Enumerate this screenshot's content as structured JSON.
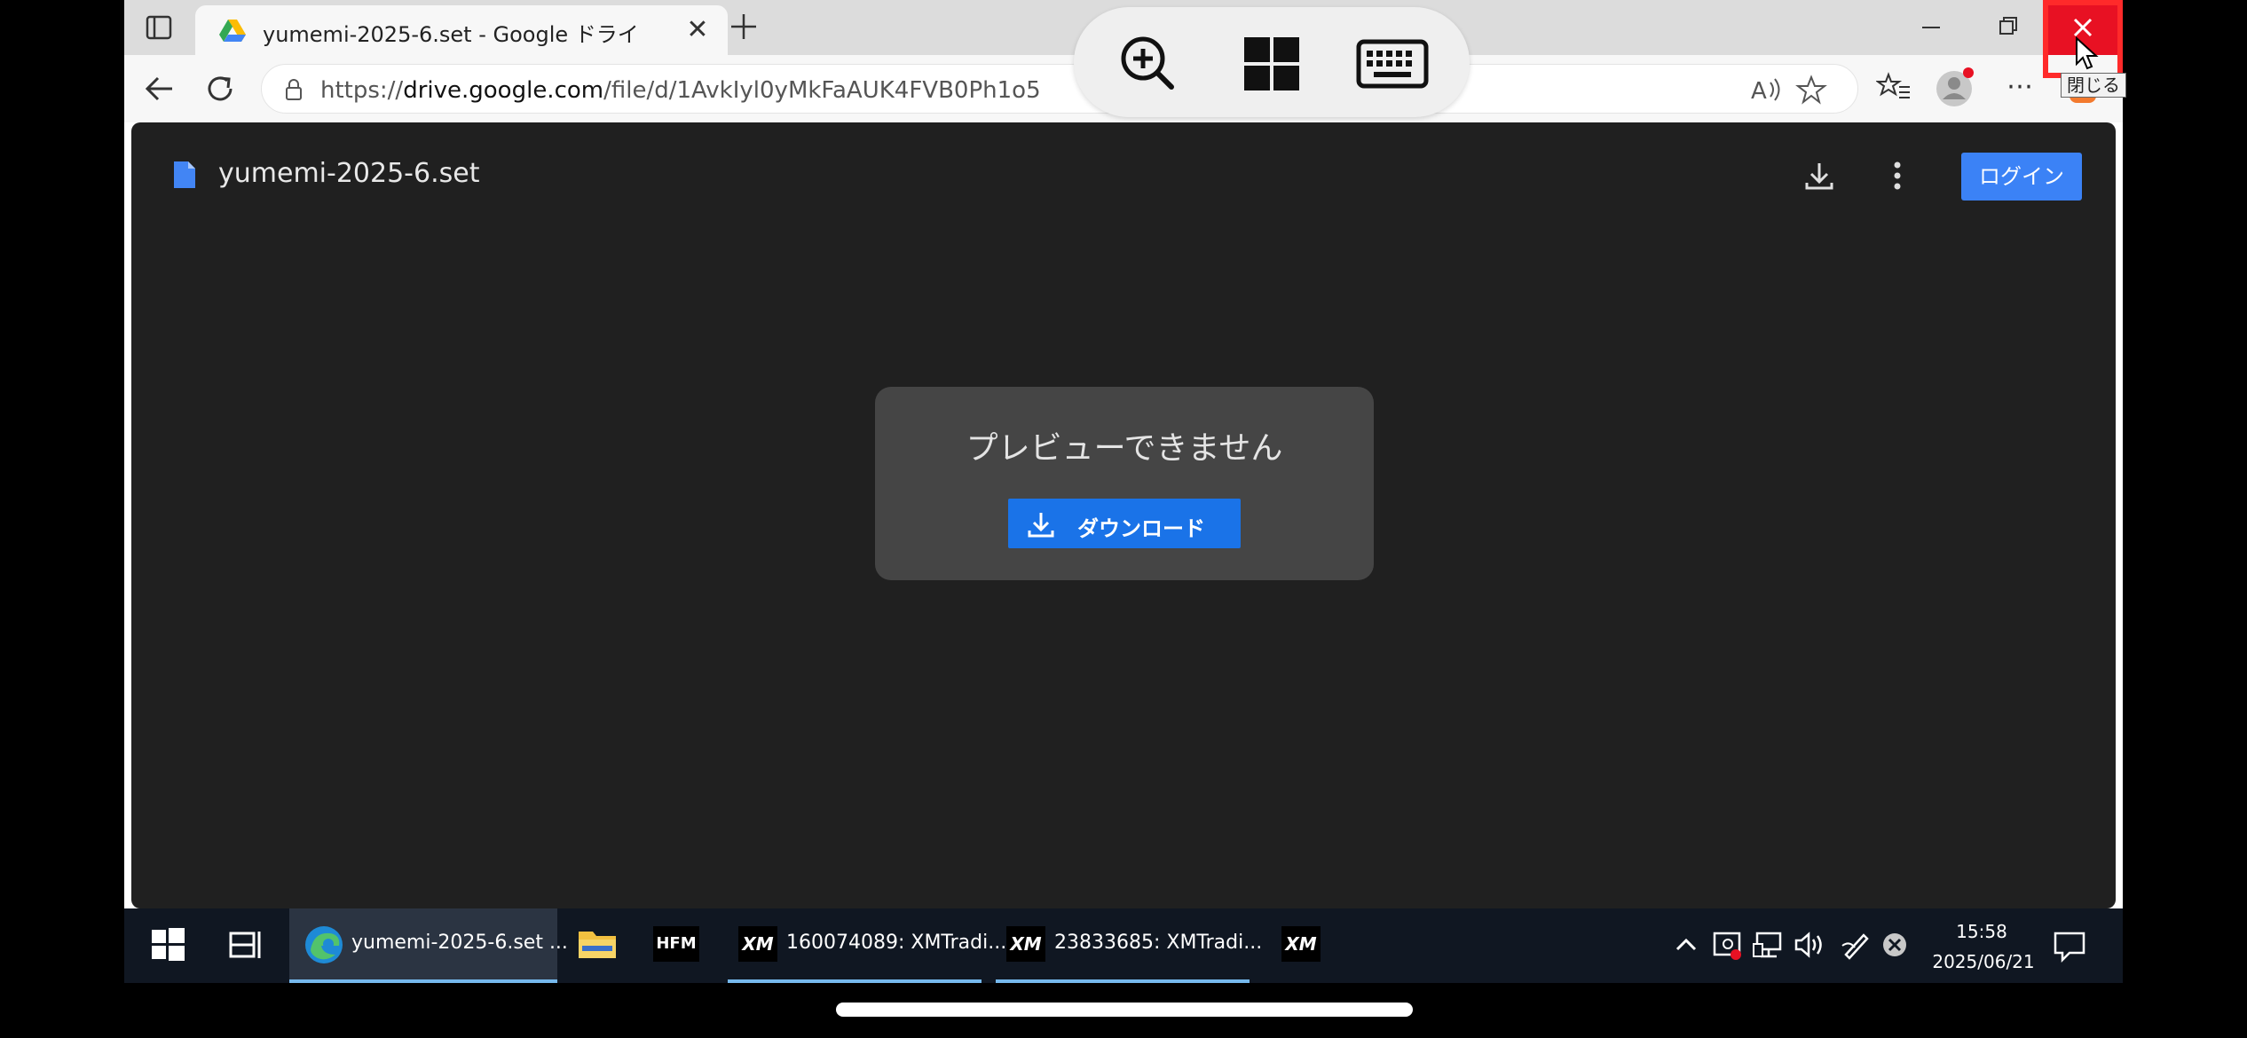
{
  "browser": {
    "tab_title": "yumemi-2025-6.set - Google ドライ",
    "url_prefix": "https://",
    "url_domain": "drive.google.com",
    "url_path": "/file/d/1AvkIyl0yMkFaAUK4FVB0Ph1o5",
    "close_tooltip": "閉じる"
  },
  "drive": {
    "file_name": "yumemi-2025-6.set",
    "login_label": "ログイン",
    "no_preview_message": "プレビューできません",
    "download_label": "ダウンロード"
  },
  "taskbar": {
    "edge_label": "yumemi-2025-6.set ...",
    "hfm_label": "HFM",
    "xm_logo": "XM",
    "xm1_label": "160074089: XMTradi...",
    "xm2_label": "23833685: XMTradi...",
    "time": "15:58",
    "date": "2025/06/21"
  },
  "icons": {
    "rdp_toolbar": [
      "zoom-in-icon",
      "windows-icon",
      "keyboard-icon"
    ],
    "tray": [
      "chevron-up-icon",
      "security-alert-icon",
      "network-icon",
      "volume-icon",
      "pen-icon",
      "close-circle-icon",
      "notification-icon"
    ]
  },
  "colors": {
    "close_button": "#e81123",
    "highlight_border": "#ff2a2a",
    "login_button": "#3b82f6",
    "download_button": "#1a73e8",
    "viewer_bg": "#202020"
  }
}
